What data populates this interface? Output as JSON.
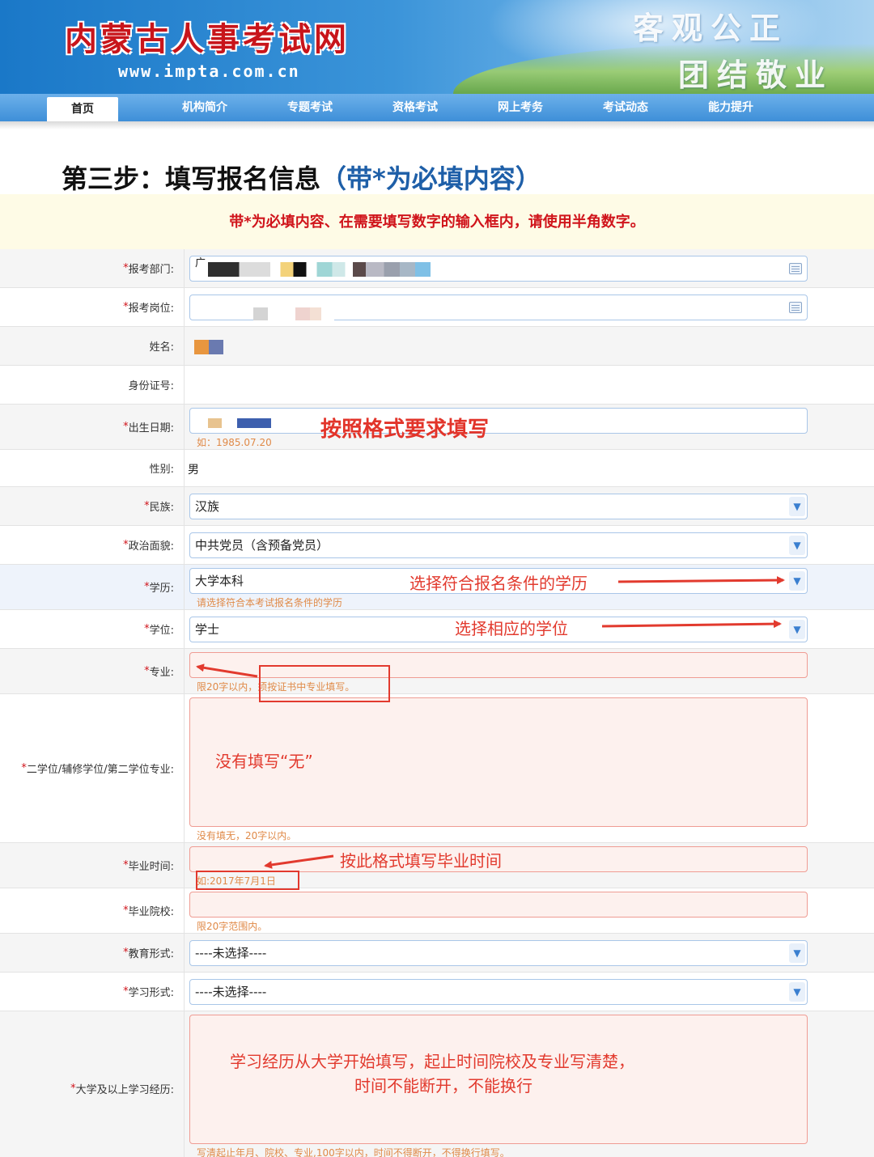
{
  "header": {
    "site_title": "内蒙古人事考试网",
    "site_url": "www.impta.com.cn",
    "slogan_line1": "客观公正",
    "slogan_line2": "团结敬业"
  },
  "nav": {
    "items": [
      "首页",
      "机构简介",
      "专题考试",
      "资格考试",
      "网上考务",
      "考试动态",
      "能力提升"
    ],
    "active": "首页"
  },
  "page": {
    "step_title": "第三步：填写报名信息",
    "step_title_note": "（带*为必填内容）",
    "notice": "带*为必填内容、在需要填写数字的输入框内，请使用半角数字。"
  },
  "form": {
    "department": {
      "label": "报考部门:",
      "value_prefix": "广"
    },
    "position": {
      "label": "报考岗位:"
    },
    "name": {
      "label": "姓名:"
    },
    "id_number": {
      "label": "身份证号:"
    },
    "birth_date": {
      "label": "出生日期:",
      "hint": "如：1985.07.20"
    },
    "gender": {
      "label": "性别:",
      "value": "男"
    },
    "ethnicity": {
      "label": "民族:",
      "value": "汉族"
    },
    "political_status": {
      "label": "政治面貌:",
      "value": "中共党员（含预备党员）"
    },
    "education": {
      "label": "学历:",
      "value": "大学本科",
      "hint": "请选择符合本考试报名条件的学历"
    },
    "degree": {
      "label": "学位:",
      "value": "学士"
    },
    "major": {
      "label": "专业:",
      "hint_a": "限20字以内，",
      "hint_b": "须按证书中专业填写。"
    },
    "second_major": {
      "label": "二学位/辅修学位/第二学位专业:",
      "hint": "没有填无，20字以内。"
    },
    "graduation_time": {
      "label": "毕业时间:",
      "hint": "如:2017年7月1日"
    },
    "graduation_school": {
      "label": "毕业院校:",
      "hint": "限20字范围内。"
    },
    "education_form": {
      "label": "教育形式:",
      "value": "----未选择----"
    },
    "study_form": {
      "label": "学习形式:",
      "value": "----未选择----"
    },
    "study_history": {
      "label": "大学及以上学习经历:",
      "hint": "写清起止年月、院校、专业,100字以内，时间不得断开，不得换行填写。"
    }
  },
  "annotations": {
    "birth_format": "按照格式要求填写",
    "education_choose": "选择符合报名条件的学历",
    "degree_choose": "选择相应的学位",
    "second_major_none": "没有填写“无”",
    "graduation_format": "按此格式填写毕业时间",
    "history_line1": "学习经历从大学开始填写，起止时间院校及专业写清楚，",
    "history_line2": "时间不能断开，不能换行"
  },
  "colors": {
    "brand_red": "#c8151b",
    "nav_blue": "#3e8fd8",
    "annotation_red": "#e23a2e",
    "hint_orange": "#e08a48"
  },
  "icons": {
    "calendar": "calendar-icon",
    "select": "chevron-down-icon"
  }
}
